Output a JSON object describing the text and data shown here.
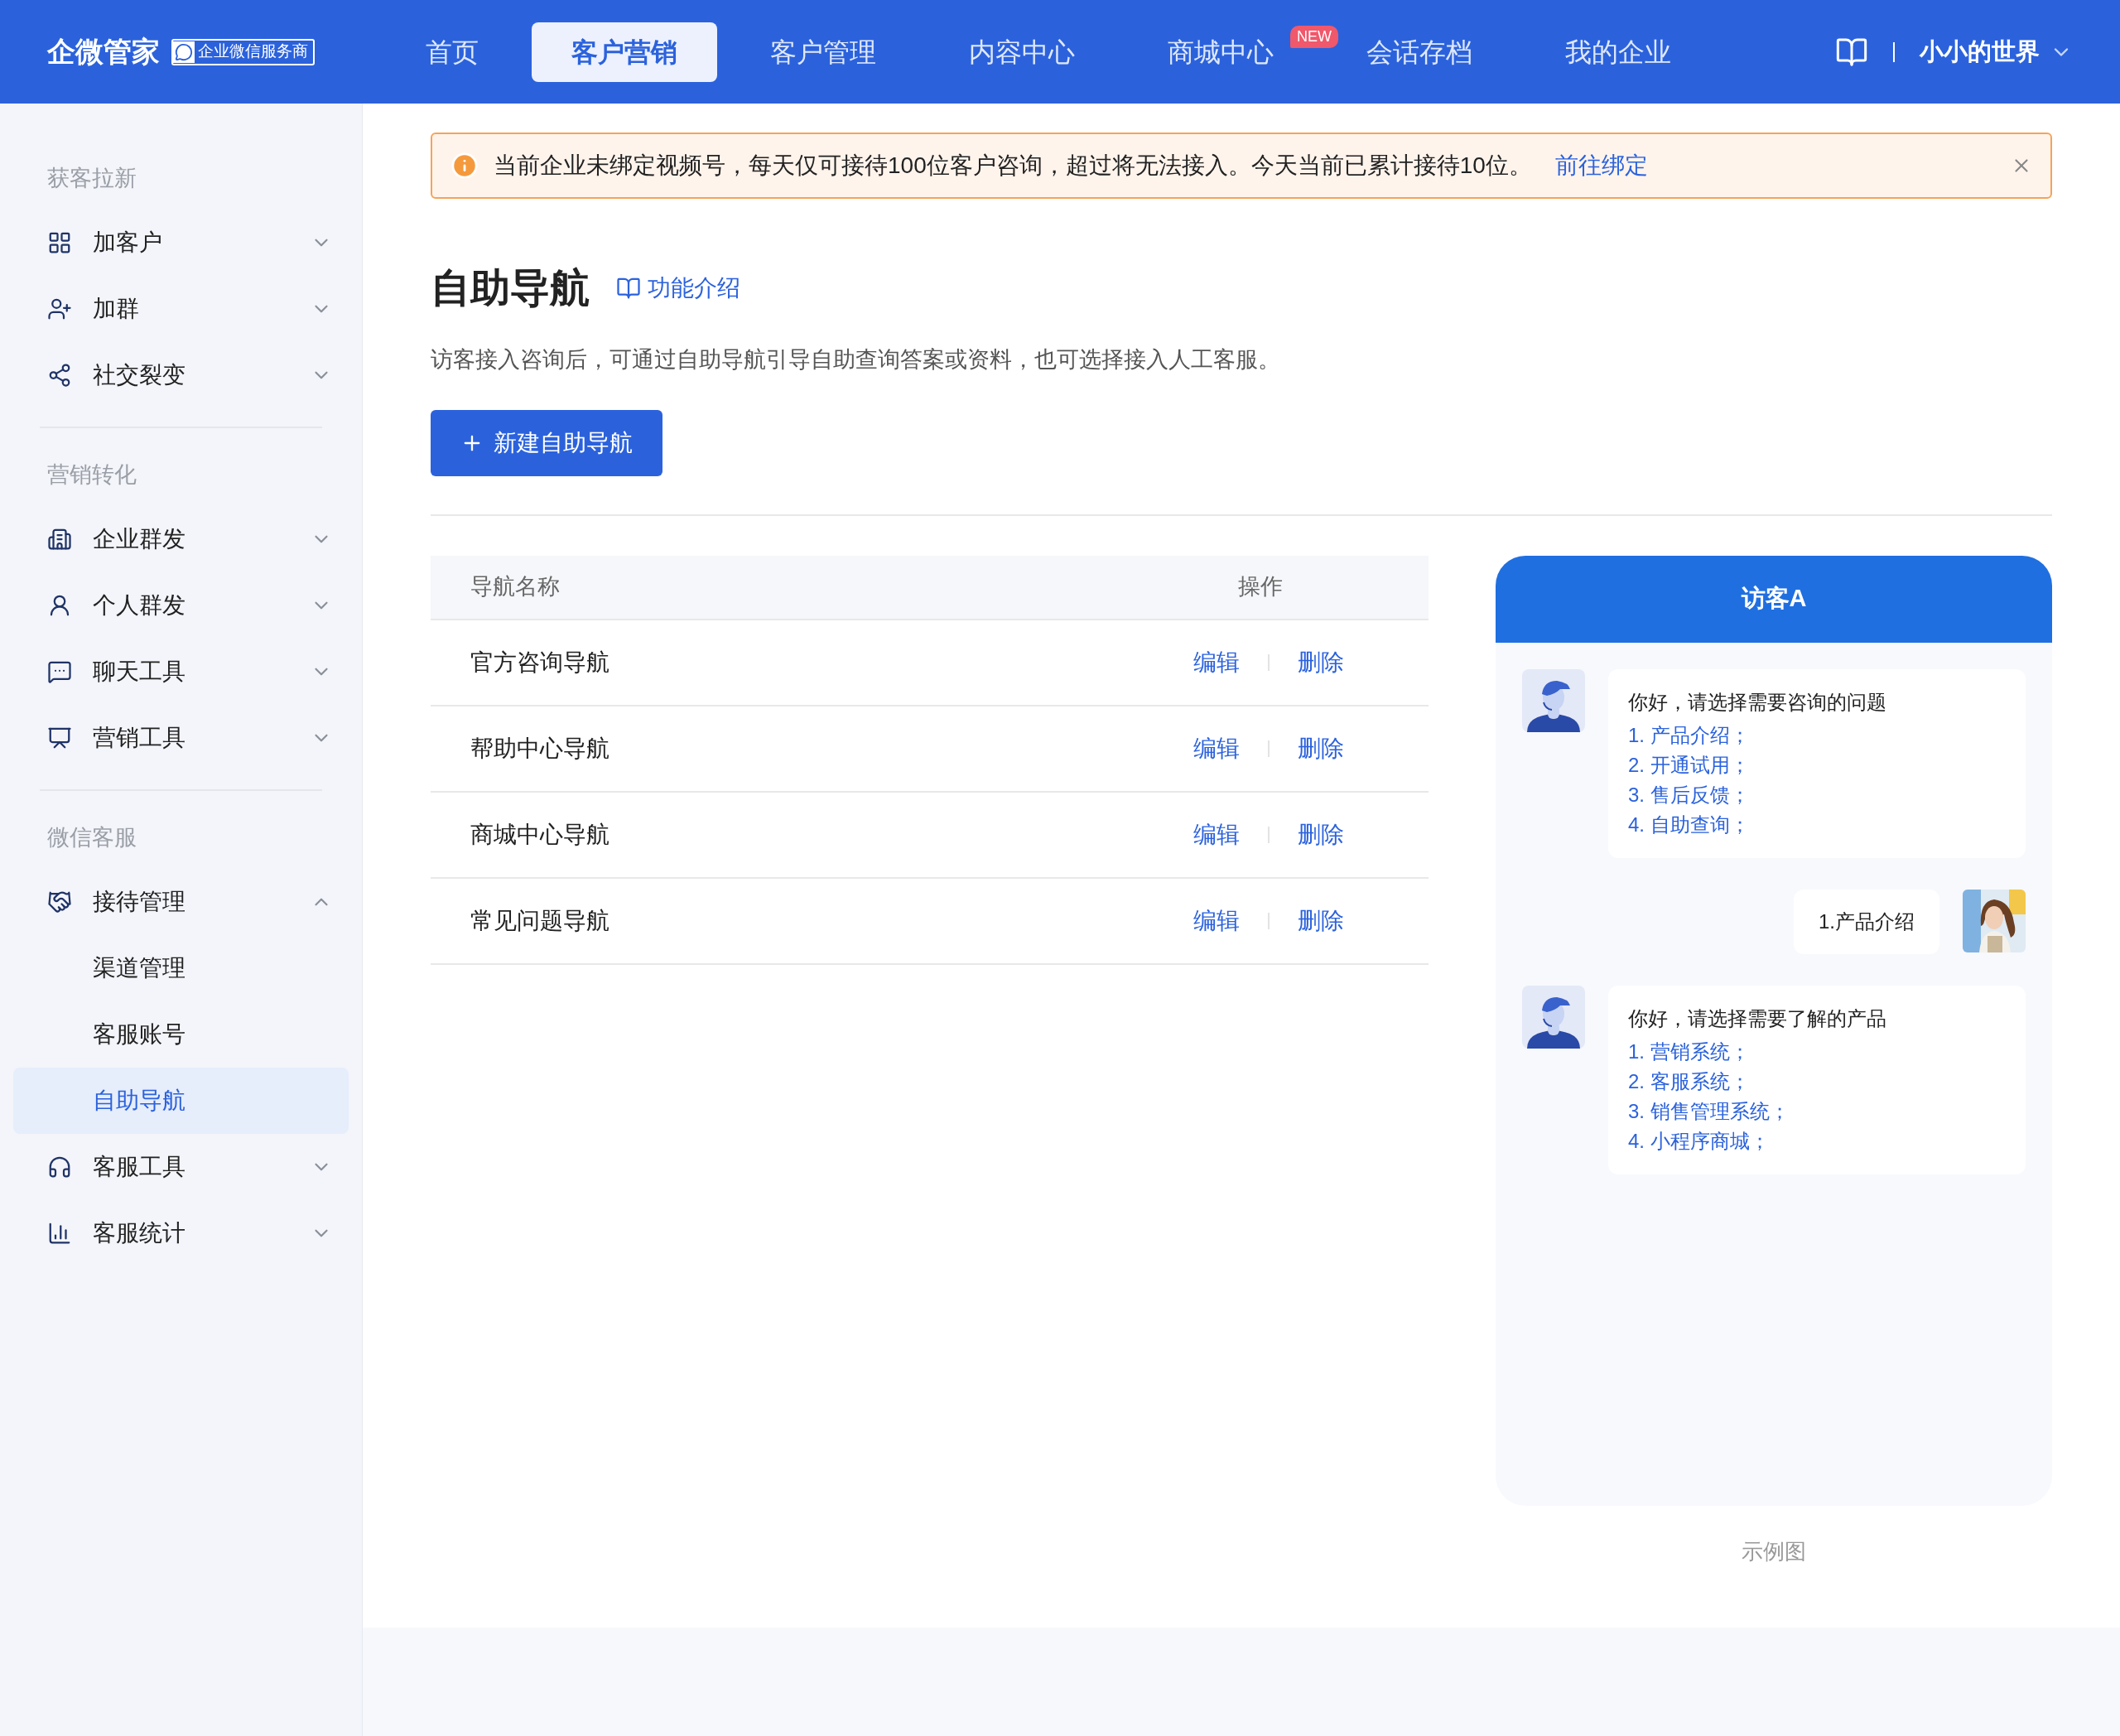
{
  "header": {
    "logo": "企微管家",
    "badge": "企业微信服务商",
    "nav": [
      {
        "label": "首页",
        "selected": false
      },
      {
        "label": "客户营销",
        "selected": true
      },
      {
        "label": "客户管理",
        "selected": false
      },
      {
        "label": "内容中心",
        "selected": false
      },
      {
        "label": "商城中心",
        "selected": false,
        "badge": "NEW"
      },
      {
        "label": "会话存档",
        "selected": false
      },
      {
        "label": "我的企业",
        "selected": false
      }
    ],
    "user": "小小的世界"
  },
  "sidebar": {
    "sections": [
      {
        "title": "获客拉新",
        "items": [
          {
            "label": "加客户",
            "expanded": false
          },
          {
            "label": "加群",
            "expanded": false
          },
          {
            "label": "社交裂变",
            "expanded": false
          }
        ]
      },
      {
        "title": "营销转化",
        "items": [
          {
            "label": "企业群发",
            "expanded": false
          },
          {
            "label": "个人群发",
            "expanded": false
          },
          {
            "label": "聊天工具",
            "expanded": false
          },
          {
            "label": "营销工具",
            "expanded": false
          }
        ]
      },
      {
        "title": "微信客服",
        "items": [
          {
            "label": "接待管理",
            "expanded": true,
            "children": [
              {
                "label": "渠道管理",
                "selected": false
              },
              {
                "label": "客服账号",
                "selected": false
              },
              {
                "label": "自助导航",
                "selected": true
              }
            ]
          },
          {
            "label": "客服工具",
            "expanded": false
          },
          {
            "label": "客服统计",
            "expanded": false
          }
        ]
      }
    ]
  },
  "alert": {
    "text": "当前企业未绑定视频号，每天仅可接待100位客户咨询，超过将无法接入。今天当前已累计接待10位。",
    "link": "前往绑定"
  },
  "page": {
    "title": "自助导航",
    "intro_link": "功能介绍",
    "description": "访客接入咨询后，可通过自助导航引导自助查询答案或资料，也可选择接入人工客服。",
    "new_button": "新建自助导航"
  },
  "table": {
    "columns": [
      "导航名称",
      "操作"
    ],
    "rows": [
      {
        "name": "官方咨询导航",
        "actions": [
          "编辑",
          "删除"
        ]
      },
      {
        "name": "帮助中心导航",
        "actions": [
          "编辑",
          "删除"
        ]
      },
      {
        "name": "商城中心导航",
        "actions": [
          "编辑",
          "删除"
        ]
      },
      {
        "name": "常见问题导航",
        "actions": [
          "编辑",
          "删除"
        ]
      }
    ]
  },
  "preview": {
    "title": "访客A",
    "messages": [
      {
        "kind": "agent",
        "text": "你好，请选择需要咨询的问题",
        "options": [
          "1. 产品介绍；",
          "2. 开通试用；",
          "3. 售后反馈；",
          "4. 自助查询；"
        ]
      },
      {
        "kind": "visitor",
        "text": "1.产品介绍"
      },
      {
        "kind": "agent",
        "text": "你好，请选择需要了解的产品",
        "options": [
          "1. 营销系统；",
          "2. 客服系统；",
          "3. 销售管理系统；",
          "4. 小程序商城；"
        ]
      }
    ],
    "caption": "示例图"
  }
}
